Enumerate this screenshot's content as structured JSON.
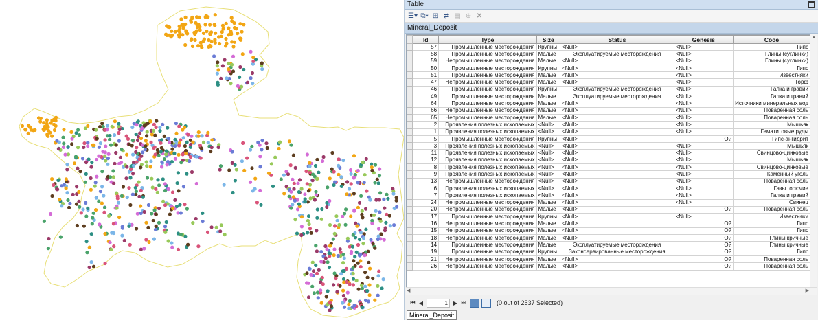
{
  "window": {
    "title": "Table"
  },
  "toolbar": {
    "icons": [
      "table-options-icon",
      "related-tables-icon",
      "select-by-attributes-icon",
      "switch-selection-icon",
      "clear-selection-icon",
      "zoom-to-selected-icon",
      "delete-selected-icon"
    ]
  },
  "table": {
    "name": "Mineral_Deposit",
    "columns": [
      "Id",
      "Type",
      "Size",
      "Status",
      "Genesis",
      "Code"
    ],
    "rows": [
      [
        "57",
        "Промышленные месторождения",
        "Крупны",
        "<Null>",
        "<Null>",
        "Гипс"
      ],
      [
        "58",
        "Промышленные месторождения",
        "Малые",
        "Эксплуатируемые месторождения",
        "<Null>",
        "Глины (суглинки)"
      ],
      [
        "59",
        "Непромышленные месторождения",
        "Малые",
        "<Null>",
        "<Null>",
        "Глины (суглинки)"
      ],
      [
        "50",
        "Промышленные месторождения",
        "Крупны",
        "<Null>",
        "<Null>",
        "Гипс"
      ],
      [
        "51",
        "Промышленные месторождения",
        "Малые",
        "<Null>",
        "<Null>",
        "Известняки"
      ],
      [
        "47",
        "Непромышленные месторождения",
        "Малые",
        "<Null>",
        "<Null>",
        "Торф"
      ],
      [
        "46",
        "Промышленные месторождения",
        "Крупны",
        "Эксплуатируемые месторождения",
        "<Null>",
        "Галка и гравий"
      ],
      [
        "49",
        "Промышленные месторождения",
        "Малые",
        "Эксплуатируемые месторождения",
        "<Null>",
        "Галка и гравий"
      ],
      [
        "64",
        "Промышленные месторождения",
        "Малые",
        "<Null>",
        "<Null>",
        "Источники минеральных вод"
      ],
      [
        "66",
        "Непромышленные месторождения",
        "Малые",
        "<Null>",
        "<Null>",
        "Поваренная соль"
      ],
      [
        "65",
        "Непромышленные месторождения",
        "Малые",
        "<Null>",
        "<Null>",
        "Поваренная соль"
      ],
      [
        "2",
        "Проявления полезных ископаемых",
        "<Null>",
        "<Null>",
        "<Null>",
        "Мышьяк"
      ],
      [
        "1",
        "Проявления полезных ископаемых",
        "<Null>",
        "<Null>",
        "<Null>",
        "Гематитовые руды"
      ],
      [
        "5",
        "Промышленные месторождения",
        "Крупны",
        "<Null>",
        "O?",
        "Гипс-ангидрит"
      ],
      [
        "3",
        "Проявления полезных ископаемых",
        "<Null>",
        "<Null>",
        "<Null>",
        "Мышьяк"
      ],
      [
        "11",
        "Проявления полезных ископаемых",
        "<Null>",
        "<Null>",
        "<Null>",
        "Свинцово-цинковые"
      ],
      [
        "12",
        "Проявления полезных ископаемых",
        "<Null>",
        "<Null>",
        "<Null>",
        "Мышьяк"
      ],
      [
        "8",
        "Проявления полезных ископаемых",
        "<Null>",
        "<Null>",
        "<Null>",
        "Свинцово-цинковые"
      ],
      [
        "9",
        "Проявления полезных ископаемых",
        "<Null>",
        "<Null>",
        "<Null>",
        "Каменный уголь"
      ],
      [
        "13",
        "Непромышленные месторождения",
        "<Null>",
        "<Null>",
        "<Null>",
        "Поваренная соль"
      ],
      [
        "6",
        "Проявления полезных ископаемых",
        "<Null>",
        "<Null>",
        "<Null>",
        "Газы горючие"
      ],
      [
        "7",
        "Проявления полезных ископаемых",
        "<Null>",
        "<Null>",
        "<Null>",
        "Галка и гравий"
      ],
      [
        "24",
        "Непромышленные месторождения",
        "Малые",
        "<Null>",
        "<Null>",
        "Свинец"
      ],
      [
        "20",
        "Непромышленные месторождения",
        "Малые",
        "<Null>",
        "O?",
        "Поваренная соль"
      ],
      [
        "17",
        "Промышленные месторождения",
        "Крупны",
        "<Null>",
        "<Null>",
        "Известняки"
      ],
      [
        "16",
        "Непромышленные месторождения",
        "Малые",
        "<Null>",
        "O?",
        "Гипс"
      ],
      [
        "15",
        "Непромышленные месторождения",
        "Малые",
        "<Null>",
        "O?",
        "Гипс"
      ],
      [
        "18",
        "Непромышленные месторождения",
        "Малые",
        "<Null>",
        "O?",
        "Глины кричные"
      ],
      [
        "14",
        "Промышленные месторождения",
        "Малые",
        "Эксплуатируемые месторождения",
        "O?",
        "Глины кричные"
      ],
      [
        "19",
        "Промышленные месторождения",
        "Крупны",
        "Законсервированные месторождения",
        "O?",
        "Гипс"
      ],
      [
        "21",
        "Непромышленные месторождения",
        "Малые",
        "<Null>",
        "O?",
        "Поваренная соль"
      ],
      [
        "26",
        "Непромышленные месторождения",
        "Малые",
        "<Null>",
        "O?",
        "Поваренная соль"
      ]
    ]
  },
  "navigation": {
    "current_record": "1",
    "selection_text": "(0 out of 2537 Selected)"
  },
  "layer_tab": {
    "label": "Mineral_Deposit"
  },
  "map": {
    "outline_color": "#e8df78",
    "point_colors": [
      "#f2a614",
      "#5d3d1f",
      "#6b7cd6",
      "#9b3a68",
      "#4aa36a",
      "#d46cd6",
      "#98c95a",
      "#2d8f84",
      "#d9547a",
      "#7bb6e8"
    ]
  }
}
